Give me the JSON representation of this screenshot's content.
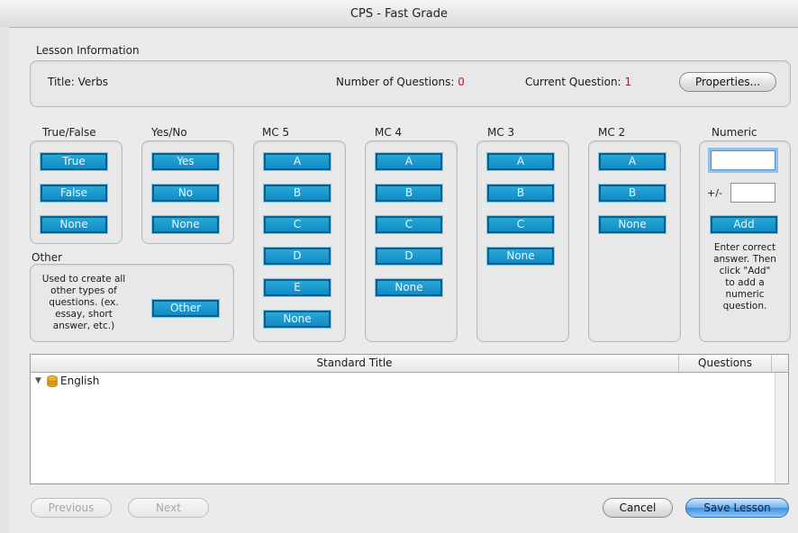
{
  "window": {
    "title": "CPS - Fast Grade"
  },
  "lesson": {
    "section_label": "Lesson Information",
    "title_label": "Title:",
    "title_value": "Verbs",
    "num_questions_label": "Number of Questions:",
    "num_questions_value": "0",
    "current_question_label": "Current Question:",
    "current_question_value": "1",
    "properties_button": "Properties..."
  },
  "groups": {
    "true_false": {
      "label": "True/False",
      "buttons": [
        "True",
        "False",
        "None"
      ]
    },
    "yes_no": {
      "label": "Yes/No",
      "buttons": [
        "Yes",
        "No",
        "None"
      ]
    },
    "mc5": {
      "label": "MC 5",
      "buttons": [
        "A",
        "B",
        "C",
        "D",
        "E",
        "None"
      ]
    },
    "mc4": {
      "label": "MC 4",
      "buttons": [
        "A",
        "B",
        "C",
        "D",
        "None"
      ]
    },
    "mc3": {
      "label": "MC 3",
      "buttons": [
        "A",
        "B",
        "C",
        "None"
      ]
    },
    "mc2": {
      "label": "MC 2",
      "buttons": [
        "A",
        "B",
        "None"
      ]
    },
    "numeric": {
      "label": "Numeric",
      "answer_value": "",
      "tolerance_label": "+/-",
      "tolerance_value": "",
      "add_button": "Add",
      "help_lines": [
        "Enter correct",
        "answer. Then",
        "click \"Add\"",
        "to add a",
        "numeric",
        "question."
      ]
    },
    "other": {
      "label": "Other",
      "description_lines": [
        "Used to create all",
        "other types of",
        "questions. (ex.",
        "essay, short",
        "answer, etc.)"
      ],
      "button": "Other"
    }
  },
  "standards_table": {
    "columns": [
      "Standard Title",
      "Questions"
    ],
    "rows": [
      {
        "expander": "▼",
        "icon": "database-icon",
        "label": "English"
      }
    ]
  },
  "footer": {
    "previous": "Previous",
    "next": "Next",
    "cancel": "Cancel",
    "save": "Save Lesson"
  },
  "colors": {
    "answer_button": "#1592cf",
    "accent_red": "#b0182a"
  }
}
